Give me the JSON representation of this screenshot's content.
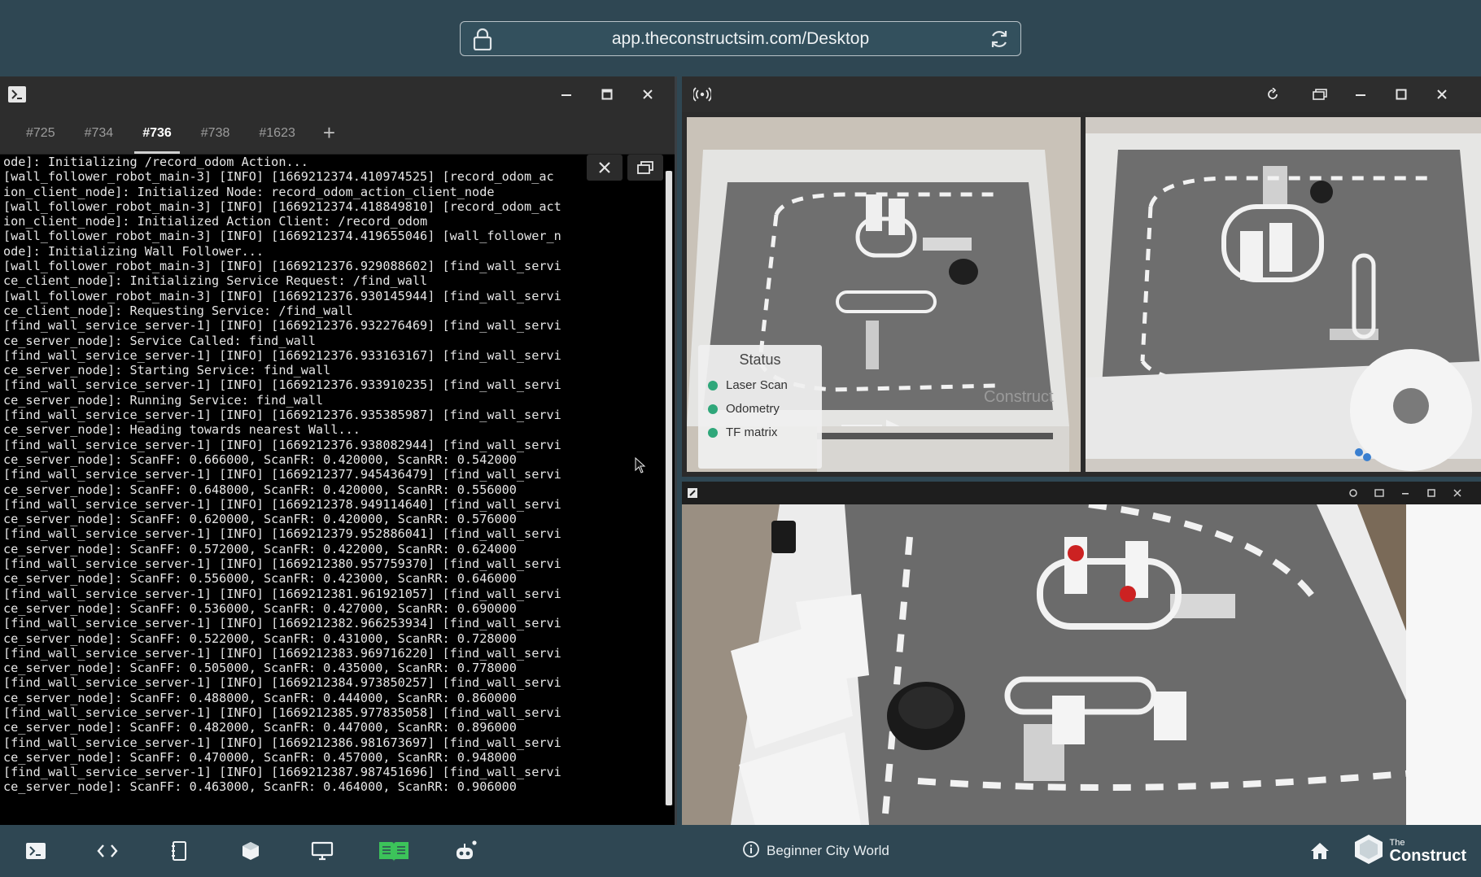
{
  "browser": {
    "url": "app.theconstructsim.com/Desktop"
  },
  "terminal": {
    "tabs": [
      "#725",
      "#734",
      "#736",
      "#738",
      "#1623"
    ],
    "active_tab": "#736",
    "add_tab_label": "+",
    "lines": [
      "ode]: Initializing /record_odom Action...",
      "[wall_follower_robot_main-3] [INFO] [1669212374.410974525] [record_odom_ac",
      "ion_client_node]: Initialized Node: record_odom_action_client_node",
      "[wall_follower_robot_main-3] [INFO] [1669212374.418849810] [record_odom_act",
      "ion_client_node]: Initialized Action Client: /record_odom",
      "[wall_follower_robot_main-3] [INFO] [1669212374.419655046] [wall_follower_n",
      "ode]: Initializing Wall Follower...",
      "[wall_follower_robot_main-3] [INFO] [1669212376.929088602] [find_wall_servi",
      "ce_client_node]: Initializing Service Request: /find_wall",
      "[wall_follower_robot_main-3] [INFO] [1669212376.930145944] [find_wall_servi",
      "ce_client_node]: Requesting Service: /find_wall",
      "[find_wall_service_server-1] [INFO] [1669212376.932276469] [find_wall_servi",
      "ce_server_node]: Service Called: find_wall",
      "[find_wall_service_server-1] [INFO] [1669212376.933163167] [find_wall_servi",
      "ce_server_node]: Starting Service: find_wall",
      "[find_wall_service_server-1] [INFO] [1669212376.933910235] [find_wall_servi",
      "ce_server_node]: Running Service: find_wall",
      "[find_wall_service_server-1] [INFO] [1669212376.935385987] [find_wall_servi",
      "ce_server_node]: Heading towards nearest Wall...",
      "[find_wall_service_server-1] [INFO] [1669212376.938082944] [find_wall_servi",
      "ce_server_node]: ScanFF: 0.666000, ScanFR: 0.420000, ScanRR: 0.542000",
      "[find_wall_service_server-1] [INFO] [1669212377.945436479] [find_wall_servi",
      "ce_server_node]: ScanFF: 0.648000, ScanFR: 0.420000, ScanRR: 0.556000",
      "[find_wall_service_server-1] [INFO] [1669212378.949114640] [find_wall_servi",
      "ce_server_node]: ScanFF: 0.620000, ScanFR: 0.420000, ScanRR: 0.576000",
      "[find_wall_service_server-1] [INFO] [1669212379.952886041] [find_wall_servi",
      "ce_server_node]: ScanFF: 0.572000, ScanFR: 0.422000, ScanRR: 0.624000",
      "[find_wall_service_server-1] [INFO] [1669212380.957759370] [find_wall_servi",
      "ce_server_node]: ScanFF: 0.556000, ScanFR: 0.423000, ScanRR: 0.646000",
      "[find_wall_service_server-1] [INFO] [1669212381.961921057] [find_wall_servi",
      "ce_server_node]: ScanFF: 0.536000, ScanFR: 0.427000, ScanRR: 0.690000",
      "[find_wall_service_server-1] [INFO] [1669212382.966253934] [find_wall_servi",
      "ce_server_node]: ScanFF: 0.522000, ScanFR: 0.431000, ScanRR: 0.728000",
      "[find_wall_service_server-1] [INFO] [1669212383.969716220] [find_wall_servi",
      "ce_server_node]: ScanFF: 0.505000, ScanFR: 0.435000, ScanRR: 0.778000",
      "[find_wall_service_server-1] [INFO] [1669212384.973850257] [find_wall_servi",
      "ce_server_node]: ScanFF: 0.488000, ScanFR: 0.444000, ScanRR: 0.860000",
      "[find_wall_service_server-1] [INFO] [1669212385.977835058] [find_wall_servi",
      "ce_server_node]: ScanFF: 0.482000, ScanFR: 0.447000, ScanRR: 0.896000",
      "[find_wall_service_server-1] [INFO] [1669212386.981673697] [find_wall_servi",
      "ce_server_node]: ScanFF: 0.470000, ScanFR: 0.457000, ScanRR: 0.948000",
      "[find_wall_service_server-1] [INFO] [1669212387.987451696] [find_wall_servi",
      "ce_server_node]: ScanFF: 0.463000, ScanFR: 0.464000, ScanRR: 0.906000"
    ]
  },
  "rviz": {
    "status": {
      "title": "Status",
      "items": [
        "Laser Scan",
        "Odometry",
        "TF matrix"
      ],
      "ok_color": "#2fa77a"
    },
    "watermark": "Construct"
  },
  "dock": {
    "world_label": "Beginner City World",
    "brand_small": "The",
    "brand_big": "Construct",
    "accent_color": "#3cc35a"
  }
}
